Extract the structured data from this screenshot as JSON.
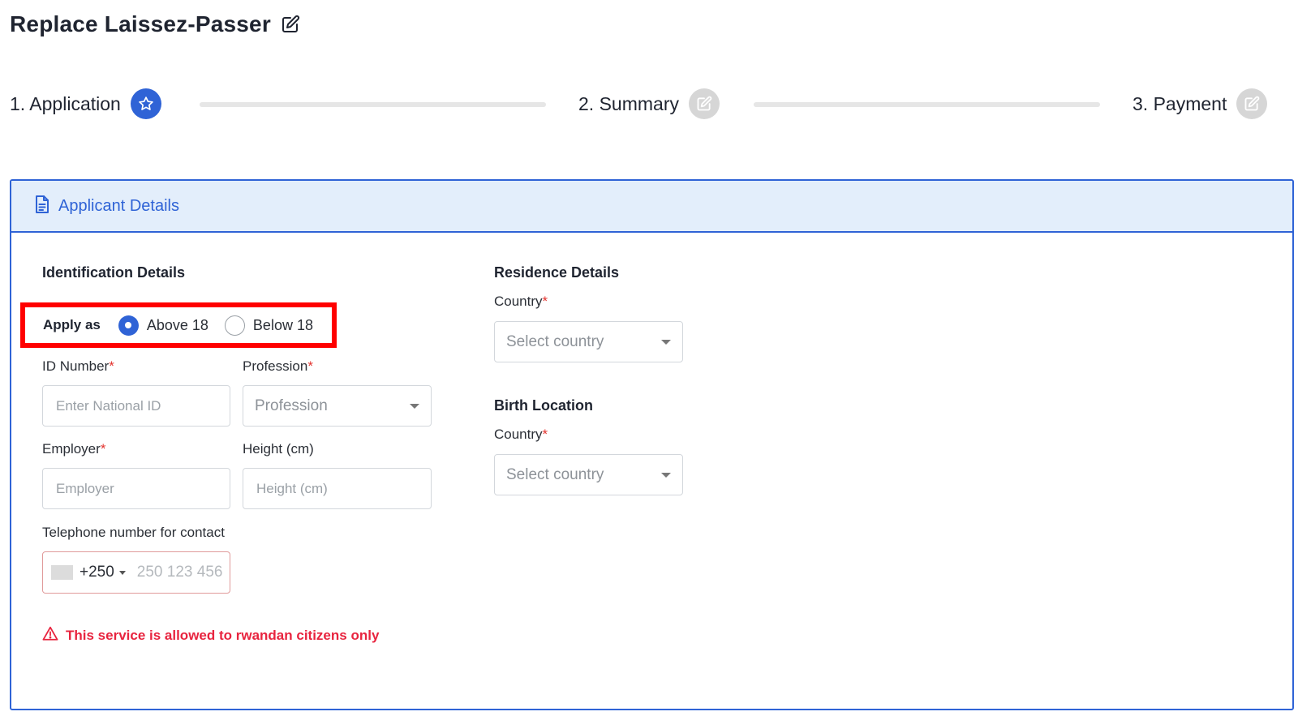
{
  "page": {
    "title": "Replace Laissez-Passer"
  },
  "stepper": {
    "steps": [
      {
        "label": "1. Application",
        "state": "active",
        "icon": "star-icon"
      },
      {
        "label": "2. Summary",
        "state": "inactive",
        "icon": "edit-icon"
      },
      {
        "label": "3. Payment",
        "state": "inactive",
        "icon": "edit-icon"
      }
    ]
  },
  "card": {
    "header": "Applicant Details",
    "header_icon": "document-icon"
  },
  "identification": {
    "title": "Identification Details",
    "apply_as": {
      "label": "Apply as",
      "options": [
        "Above 18",
        "Below 18"
      ],
      "selected": "Above 18"
    },
    "id_number": {
      "label": "ID Number",
      "required": "*",
      "placeholder": "Enter National ID",
      "value": ""
    },
    "profession": {
      "label": "Profession",
      "required": "*",
      "placeholder": "Profession"
    },
    "employer": {
      "label": "Employer",
      "required": "*",
      "placeholder": "Employer",
      "value": ""
    },
    "height": {
      "label": "Height (cm)",
      "placeholder": "Height (cm)",
      "value": ""
    },
    "telephone": {
      "label": "Telephone number for contact",
      "dial_code": "+250",
      "placeholder": "250 123 456",
      "value": ""
    }
  },
  "residence": {
    "title": "Residence Details",
    "country": {
      "label": "Country",
      "required": "*",
      "placeholder": "Select country"
    }
  },
  "birth": {
    "title": "Birth Location",
    "country": {
      "label": "Country",
      "required": "*",
      "placeholder": "Select country"
    }
  },
  "warning": {
    "text": "This service is allowed to rwandan citizens only",
    "icon": "warning-triangle-icon"
  },
  "colors": {
    "primary": "#2f63d6",
    "header_bg": "#e3eefb",
    "error": "#e8243f",
    "highlight_box": "#ff0000"
  }
}
